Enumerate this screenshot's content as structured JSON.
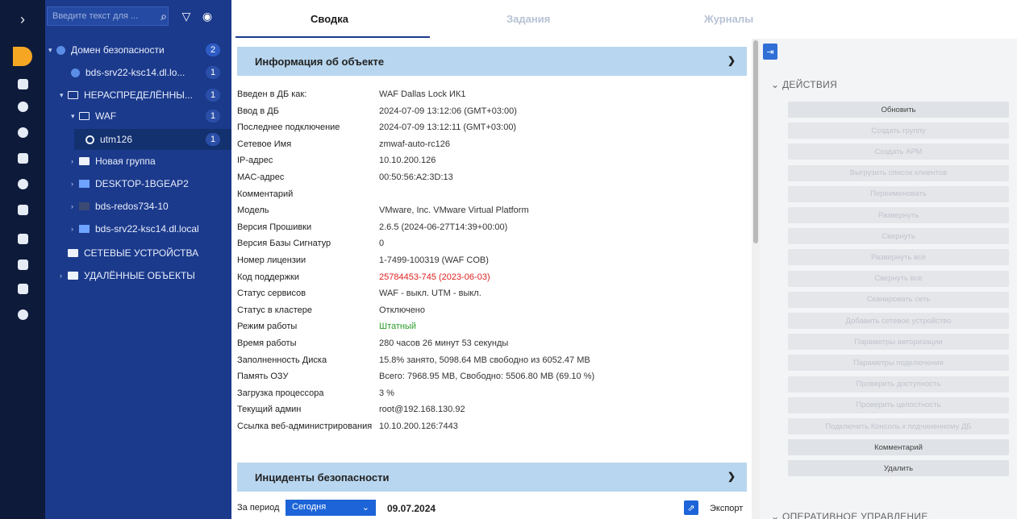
{
  "sidebar_icons": [
    "chevron-right-icon",
    "grid-icon",
    "computers-icon",
    "shield-icon",
    "settings-target-icon",
    "users-icon",
    "gear-icon",
    "network-icon",
    "server-icon",
    "monitor-icon",
    "document-icon",
    "info-icon"
  ],
  "tree": {
    "search_placeholder": "Введите текст для ...",
    "nodes": [
      {
        "label": "Домен безопасности",
        "badge": "2"
      },
      {
        "label": "bds-srv22-ksc14.dl.lo...",
        "badge": "1"
      },
      {
        "label": "НЕРАСПРЕДЕЛЁННЫ...",
        "badge": "1"
      },
      {
        "label": "WAF",
        "badge": "1"
      },
      {
        "label": "utm126",
        "badge": "1"
      },
      {
        "label": "Новая группа"
      },
      {
        "label": "DESKTOP-1BGEAP2"
      },
      {
        "label": "bds-redos734-10"
      },
      {
        "label": "bds-srv22-ksc14.dl.local"
      },
      {
        "label": "СЕТЕВЫЕ УСТРОЙСТВА"
      },
      {
        "label": "УДАЛЁННЫЕ ОБЪЕКТЫ"
      }
    ]
  },
  "tabs": [
    "Сводка",
    "Задания",
    "Журналы"
  ],
  "info_section": {
    "title": "Информация об объекте",
    "rows": [
      {
        "k": "Введен в ДБ как:",
        "v": "WAF Dallas Lock ИК1"
      },
      {
        "k": "Ввод в ДБ",
        "v": "2024-07-09 13:12:06 (GMT+03:00)"
      },
      {
        "k": "Последнее подключение",
        "v": "2024-07-09 13:12:11 (GMT+03:00)"
      },
      {
        "k": "Сетевое Имя",
        "v": "zmwaf-auto-rc126"
      },
      {
        "k": "IP-адрес",
        "v": "10.10.200.126"
      },
      {
        "k": "MAC-адрес",
        "v": "00:50:56:A2:3D:13"
      },
      {
        "k": "Комментарий",
        "v": ""
      },
      {
        "k": "Модель",
        "v": "VMware, Inc. VMware Virtual Platform"
      },
      {
        "k": "Версия Прошивки",
        "v": "2.6.5 (2024-06-27T14:39+00:00)"
      },
      {
        "k": "Версия Базы Сигнатур",
        "v": "0"
      },
      {
        "k": "Номер лицензии",
        "v": "1-7499-100319 (WAF COB)"
      },
      {
        "k": "Код поддержки",
        "v": "25784453-745 (2023-06-03)"
      },
      {
        "k": "Статус сервисов",
        "v": "WAF - выкл. UTM - выкл."
      },
      {
        "k": "Статус в кластере",
        "v": "Отключено"
      },
      {
        "k": "Режим работы",
        "v": "Штатный"
      },
      {
        "k": "Время работы",
        "v": "280 часов 26 минут 53 секунды"
      },
      {
        "k": "Заполненность Диска",
        "v": "15.8% занято, 5098.64 MB свободно из 6052.47 MB"
      },
      {
        "k": "Память ОЗУ",
        "v": "Всего: 7968.95 MB, Свободно: 5506.80 MB (69.10 %)"
      },
      {
        "k": "Загрузка процессора",
        "v": "3 %"
      },
      {
        "k": "Текущий админ",
        "v": "root@192.168.130.92"
      },
      {
        "k": "Ссылка веб-администрирования",
        "v": "10.10.200.126:7443"
      }
    ]
  },
  "incidents_section": {
    "title": "Инциденты безопасности",
    "period_label": "За период",
    "period_value": "Сегодня",
    "date": "09.07.2024",
    "export_label": "Экспорт"
  },
  "colors": {
    "support_code": "#e02020",
    "mode_normal": "#2a9d2a"
  },
  "actions": {
    "header": "ДЕЙСТВИЯ",
    "items": [
      {
        "label": "Обновить",
        "enabled": true
      },
      {
        "label": "Создать группу",
        "enabled": false
      },
      {
        "label": "Создать АРМ",
        "enabled": false
      },
      {
        "label": "Выгрузить список клиентов",
        "enabled": false
      },
      {
        "label": "Переименовать",
        "enabled": false
      },
      {
        "label": "Развернуть",
        "enabled": false
      },
      {
        "label": "Свернуть",
        "enabled": false
      },
      {
        "label": "Развернуть все",
        "enabled": false
      },
      {
        "label": "Свернуть все",
        "enabled": false
      },
      {
        "label": "Сканировать сеть",
        "enabled": false
      },
      {
        "label": "Добавить сетевое устройство",
        "enabled": false
      },
      {
        "label": "Параметры авторизации",
        "enabled": false
      },
      {
        "label": "Параметры подключения",
        "enabled": false
      },
      {
        "label": "Проверить доступность",
        "enabled": false
      },
      {
        "label": "Проверить целостность",
        "enabled": false
      },
      {
        "label": "Подключить Консоль к подчиненному ДБ",
        "enabled": false
      },
      {
        "label": "Комментарий",
        "enabled": true
      },
      {
        "label": "Удалить",
        "enabled": true
      }
    ],
    "operational_header": "ОПЕРАТИВНОЕ УПРАВЛЕНИЕ"
  }
}
